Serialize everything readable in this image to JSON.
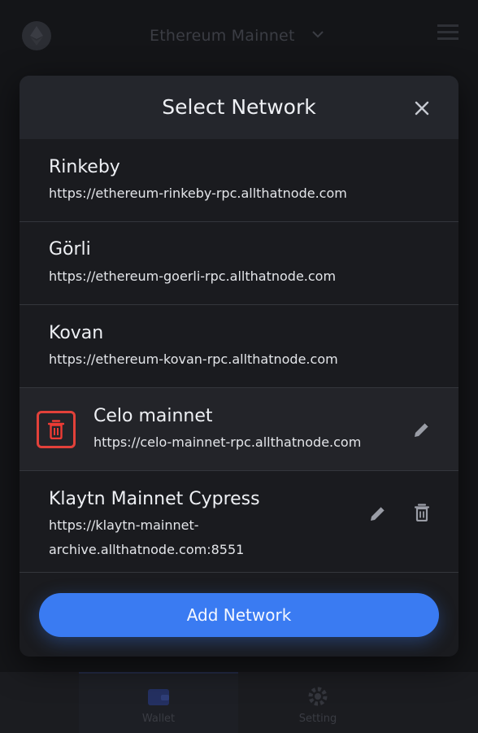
{
  "background": {
    "network_selector": "Ethereum Mainnet",
    "tabs": [
      {
        "label": "Wallet",
        "icon": "wallet-icon"
      },
      {
        "label": "Setting",
        "icon": "gear-icon"
      }
    ]
  },
  "modal": {
    "title": "Select Network",
    "close_icon": "close-icon",
    "networks": [
      {
        "name": "Rinkeby",
        "url": "https://ethereum-rinkeby-rpc.allthatnode.com"
      },
      {
        "name": "Görli",
        "url": "https://ethereum-goerli-rpc.allthatnode.com"
      },
      {
        "name": "Kovan",
        "url": "https://ethereum-kovan-rpc.allthatnode.com"
      },
      {
        "name": "Celo mainnet",
        "url": "https://celo-mainnet-rpc.allthatnode.com",
        "actions": [
          "trash-icon",
          "pencil-icon"
        ]
      },
      {
        "name": "Klaytn Mainnet Cypress",
        "url_line1": "https://klaytn-mainnet-",
        "url_line2": "archive.allthatnode.com:8551",
        "actions": [
          "pencil-icon",
          "trash-icon"
        ]
      }
    ],
    "add_button": "Add Network"
  },
  "colors": {
    "accent": "#3a7bf2",
    "danger": "#e2413a",
    "modal_bg": "#1a1b1f",
    "header_bg": "#24262c"
  }
}
